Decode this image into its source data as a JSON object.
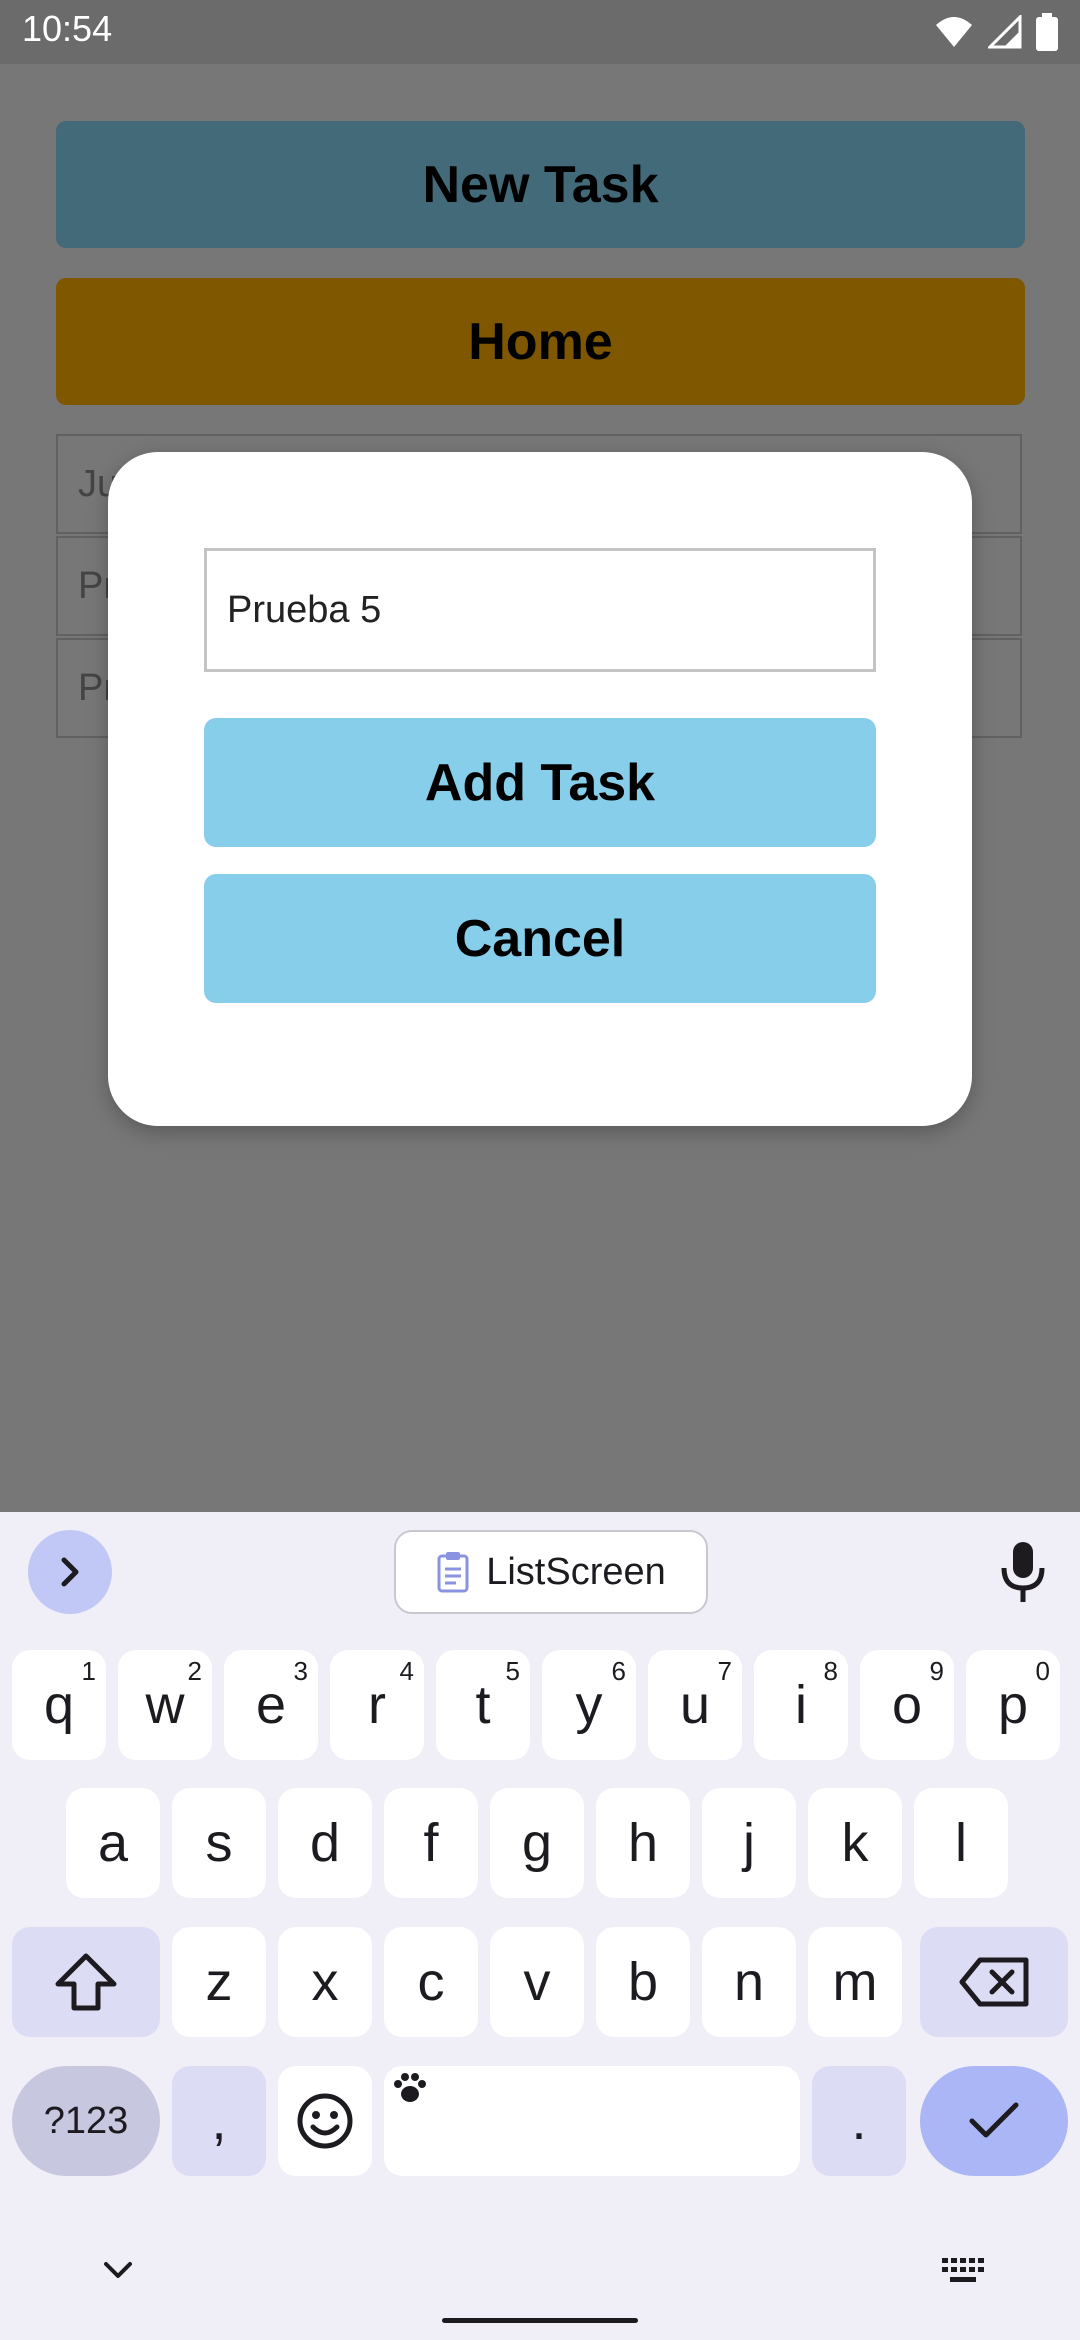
{
  "status_bar": {
    "time": "10:54",
    "icons": [
      "wifi-icon",
      "cellular-signal-icon",
      "battery-icon"
    ]
  },
  "app": {
    "new_task_label": "New Task",
    "home_label": "Home",
    "list_items": [
      "Ju",
      "Pr",
      "Pr"
    ],
    "colors": {
      "new_task": "#436a79",
      "home": "#7e5700"
    }
  },
  "dialog": {
    "input_value": "Prueba 5",
    "add_task_label": "Add Task",
    "cancel_label": "Cancel",
    "button_color": "#87ceeb"
  },
  "keyboard": {
    "clipboard_chip": "ListScreen",
    "row1": [
      {
        "key": "q",
        "num": "1"
      },
      {
        "key": "w",
        "num": "2"
      },
      {
        "key": "e",
        "num": "3"
      },
      {
        "key": "r",
        "num": "4"
      },
      {
        "key": "t",
        "num": "5"
      },
      {
        "key": "y",
        "num": "6"
      },
      {
        "key": "u",
        "num": "7"
      },
      {
        "key": "i",
        "num": "8"
      },
      {
        "key": "o",
        "num": "9"
      },
      {
        "key": "p",
        "num": "0"
      }
    ],
    "row2": [
      "a",
      "s",
      "d",
      "f",
      "g",
      "h",
      "j",
      "k",
      "l"
    ],
    "row3": [
      "z",
      "x",
      "c",
      "v",
      "b",
      "n",
      "m"
    ],
    "symbols_label": "?123",
    "comma_label": ",",
    "period_label": "."
  }
}
